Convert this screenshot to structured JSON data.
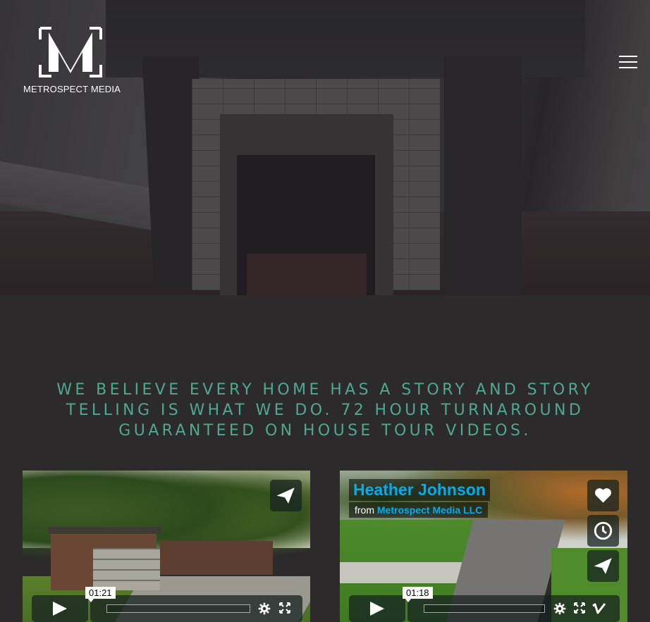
{
  "brand": {
    "name": "METROSPECT MEDIA",
    "logo_icon": "m-monogram-icon"
  },
  "nav": {
    "menu_icon": "hamburger-menu-icon"
  },
  "tagline": "WE BELIEVE EVERY HOME HAS A STORY AND STORY TELLING IS WHAT WE DO. 72 HOUR TURNAROUND GUARANTEED ON HOUSE TOUR VIDEOS.",
  "colors": {
    "accent": "#4fa98e",
    "background": "#2c2a2b",
    "vimeo_blue": "#00adef"
  },
  "videos": [
    {
      "timecode": "01:21",
      "buttons": [
        "share-icon"
      ],
      "controls": [
        "play-icon",
        "settings-icon",
        "fullscreen-icon"
      ]
    },
    {
      "title": "Heather Johnson",
      "byline_prefix": "from",
      "owner": "Metrospect Media LLC",
      "timecode": "01:18",
      "buttons": [
        "like-icon",
        "watch-later-icon",
        "share-icon"
      ],
      "controls": [
        "play-icon",
        "settings-icon",
        "fullscreen-icon",
        "vimeo-icon"
      ]
    }
  ]
}
